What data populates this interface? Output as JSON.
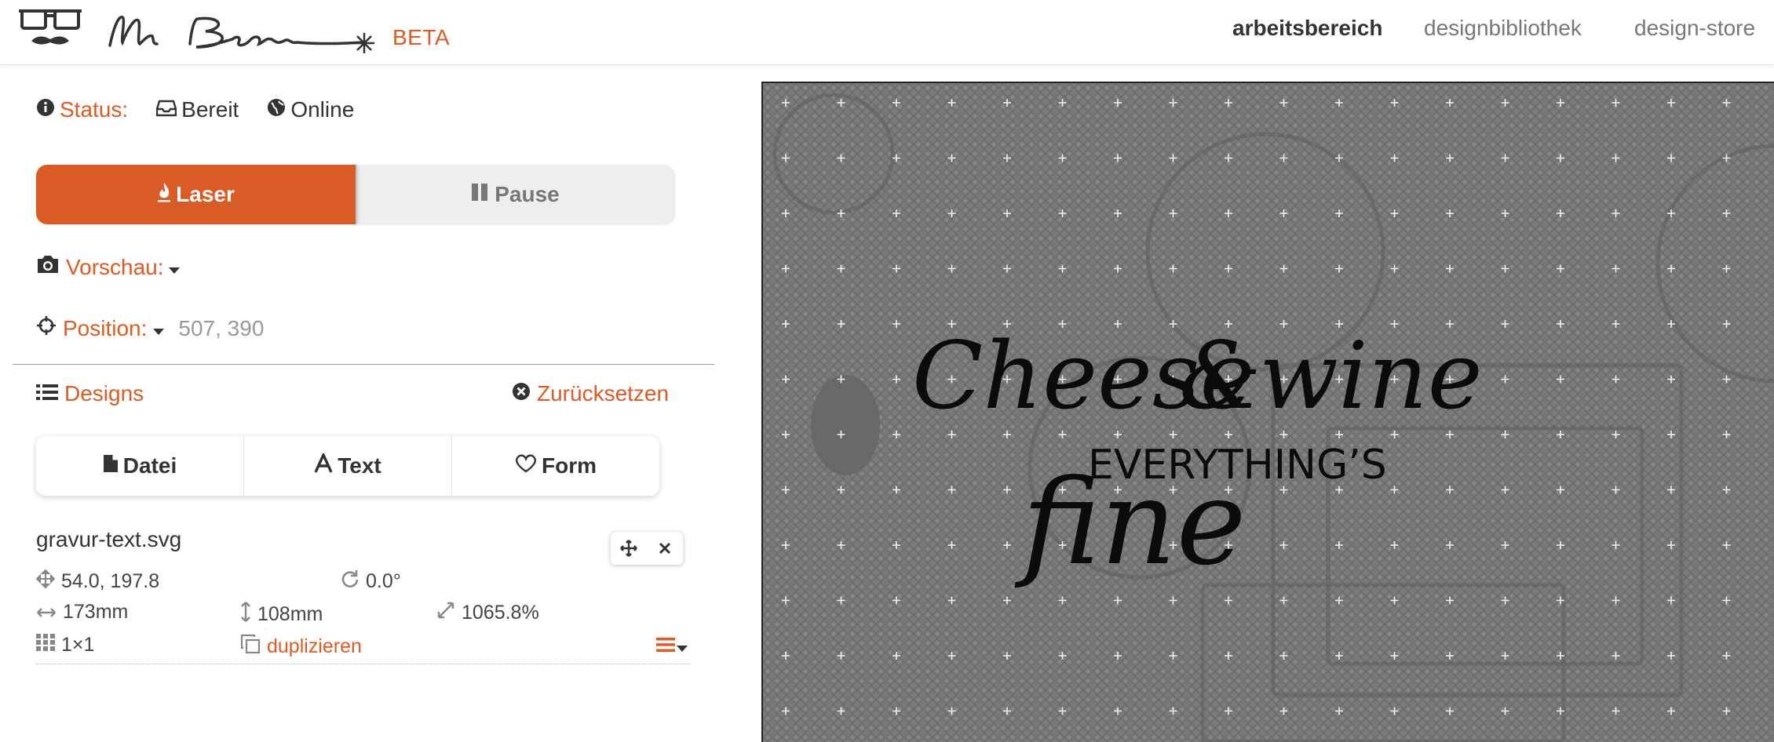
{
  "app": {
    "beta_label": "BETA"
  },
  "nav": {
    "items": [
      "arbeitsbereich",
      "designbibliothek",
      "design-store"
    ],
    "active": "arbeitsbereich"
  },
  "status": {
    "label": "Status:",
    "state": "Bereit",
    "connection": "Online"
  },
  "controls": {
    "laser_label": "Laser",
    "pause_label": "Pause"
  },
  "preview": {
    "label": "Vorschau:"
  },
  "position": {
    "label": "Position:",
    "value": "507, 390"
  },
  "designs": {
    "label": "Designs",
    "reset_label": "Zurücksetzen",
    "tabs": [
      "Datei",
      "Text",
      "Form"
    ]
  },
  "design_item": {
    "filename": "gravur-text.svg",
    "position": "54.0, 197.8",
    "rotation": "0.0°",
    "width": "173mm",
    "height": "108mm",
    "scale": "1065.8%",
    "grid": "1×1",
    "duplicate_label": "duplizieren"
  },
  "canvas": {
    "text_line1": "Cheese",
    "text_amp": "&",
    "text_wine": "wine",
    "text_caps": "EVERYTHING’S",
    "text_fine": "fine"
  },
  "colors": {
    "accent": "#e05a21",
    "laser_button": "#d95b26",
    "canvas_bg": "#777777"
  }
}
